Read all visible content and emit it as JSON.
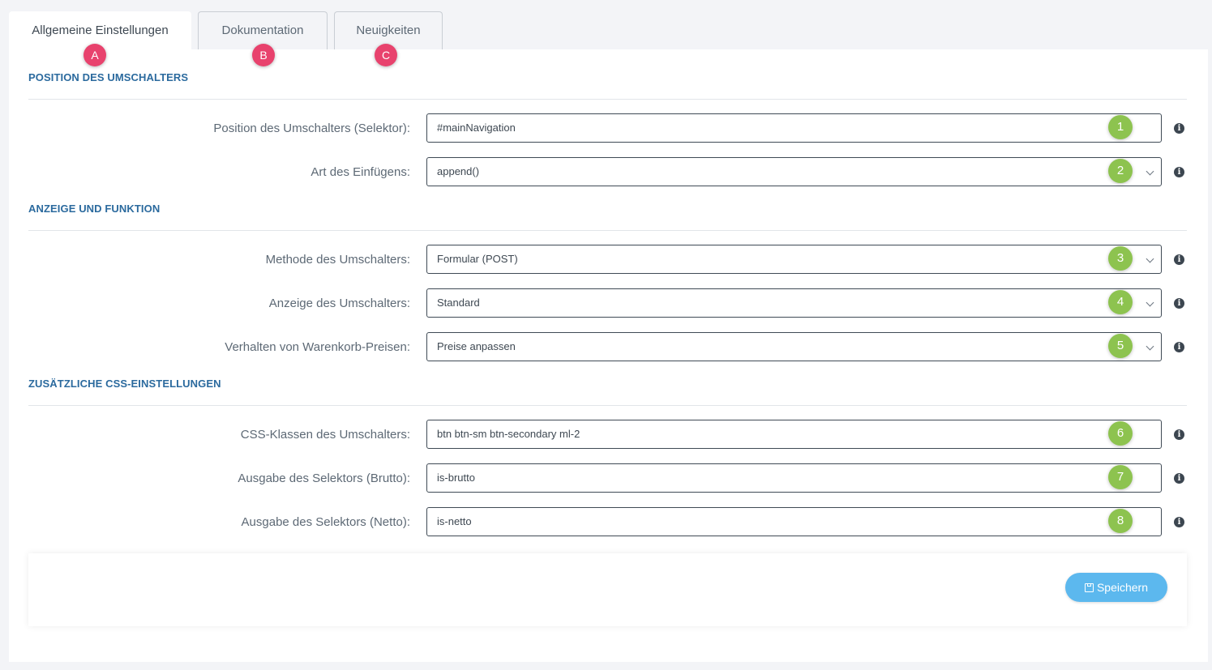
{
  "tabs": [
    {
      "label": "Allgemeine Einstellungen",
      "badge": "A"
    },
    {
      "label": "Dokumentation",
      "badge": "B"
    },
    {
      "label": "Neuigkeiten",
      "badge": "C"
    }
  ],
  "sections": [
    {
      "title": "POSITION DES UMSCHALTERS"
    },
    {
      "title": "ANZEIGE UND FUNKTION"
    },
    {
      "title": "ZUSÄTZLICHE CSS-EINSTELLUNGEN"
    }
  ],
  "fields": [
    {
      "label": "Position des Umschalters (Selektor):",
      "value": "#mainNavigation",
      "type": "input",
      "badge": "1"
    },
    {
      "label": "Art des Einfügens:",
      "value": "append()",
      "type": "select",
      "badge": "2"
    },
    {
      "label": "Methode des Umschalters:",
      "value": "Formular (POST)",
      "type": "select",
      "badge": "3"
    },
    {
      "label": "Anzeige des Umschalters:",
      "value": "Standard",
      "type": "select",
      "badge": "4"
    },
    {
      "label": "Verhalten von Warenkorb-Preisen:",
      "value": "Preise anpassen",
      "type": "select",
      "badge": "5"
    },
    {
      "label": "CSS-Klassen des Umschalters:",
      "value": "btn btn-sm btn-secondary ml-2",
      "type": "input",
      "badge": "6"
    },
    {
      "label": "Ausgabe des Selektors (Brutto):",
      "value": "is-brutto",
      "type": "input",
      "badge": "7"
    },
    {
      "label": "Ausgabe des Selektors (Netto):",
      "value": "is-netto",
      "type": "input",
      "badge": "8"
    }
  ],
  "info_icon": "info-icon",
  "save_label": "Speichern",
  "colors": {
    "section_title": "#2b6a9e",
    "number_badge": "#8dc34f",
    "letter_badge": "#e8426d",
    "save_button": "#5cb8ee"
  }
}
